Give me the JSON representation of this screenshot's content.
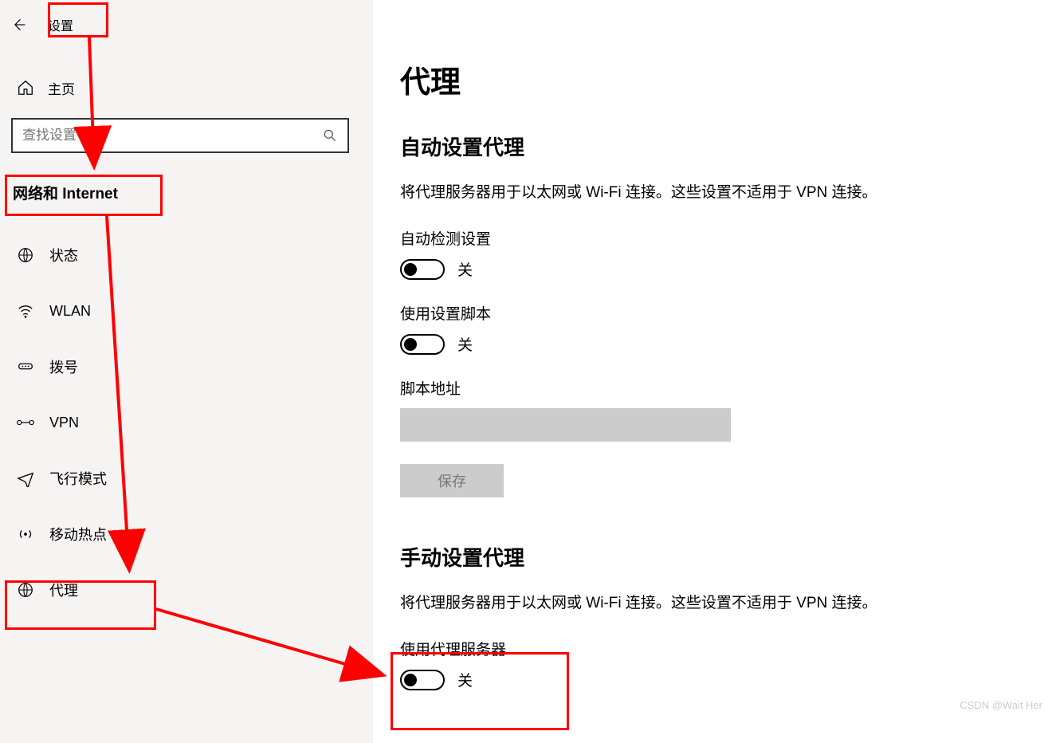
{
  "header": {
    "window_title": "设置"
  },
  "sidebar": {
    "home_label": "主页",
    "search_placeholder": "查找设置",
    "category_label": "网络和 Internet",
    "items": [
      {
        "icon": "globe-status-icon",
        "label": "状态"
      },
      {
        "icon": "wifi-icon",
        "label": "WLAN"
      },
      {
        "icon": "dialup-icon",
        "label": "拨号"
      },
      {
        "icon": "vpn-icon",
        "label": "VPN"
      },
      {
        "icon": "airplane-icon",
        "label": "飞行模式"
      },
      {
        "icon": "hotspot-icon",
        "label": "移动热点"
      },
      {
        "icon": "globe-icon",
        "label": "代理"
      }
    ]
  },
  "main": {
    "page_title": "代理",
    "auto": {
      "section_title": "自动设置代理",
      "desc": "将代理服务器用于以太网或 Wi-Fi 连接。这些设置不适用于 VPN 连接。",
      "detect_label": "自动检测设置",
      "detect_state": "关",
      "script_label": "使用设置脚本",
      "script_state": "关",
      "script_addr_label": "脚本地址",
      "save_label": "保存"
    },
    "manual": {
      "section_title": "手动设置代理",
      "desc": "将代理服务器用于以太网或 Wi-Fi 连接。这些设置不适用于 VPN 连接。",
      "use_proxy_label": "使用代理服务器",
      "use_proxy_state": "关"
    }
  },
  "watermark": "CSDN @Wait Her"
}
